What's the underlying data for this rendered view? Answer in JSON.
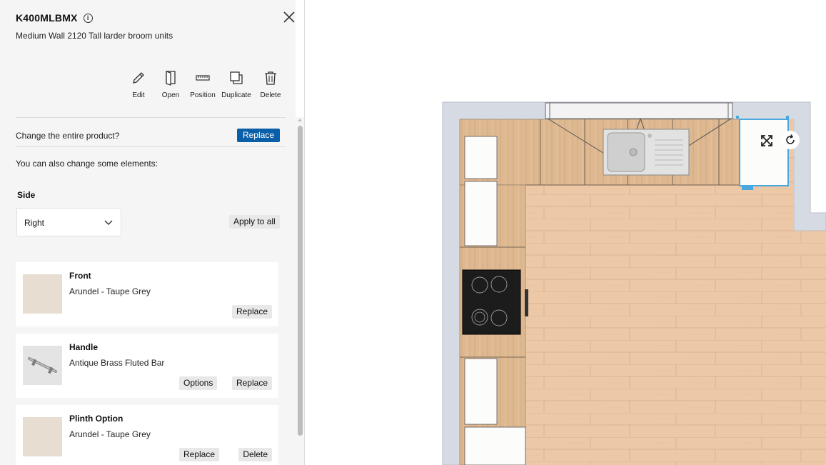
{
  "product": {
    "code": "K400MLBMX",
    "description": "Medium Wall 2120 Tall larder broom units"
  },
  "toolbar": {
    "edit": "Edit",
    "open": "Open",
    "position": "Position",
    "duplicate": "Duplicate",
    "delete": "Delete"
  },
  "change_product": {
    "text": "Change the entire product?",
    "button": "Replace"
  },
  "also_change": "You can also change some elements:",
  "side": {
    "label": "Side",
    "value": "Right",
    "apply_all": "Apply to all"
  },
  "elements": [
    {
      "name": "Front",
      "value": "Arundel - Taupe Grey",
      "replace": "Replace",
      "swatch": "#e7ddd1"
    },
    {
      "name": "Handle",
      "value": "Antique Brass Fluted Bar",
      "options": "Options",
      "replace": "Replace",
      "swatch": "#e4e4e4"
    },
    {
      "name": "Plinth Option",
      "value": "Arundel - Taupe Grey",
      "replace": "Replace",
      "delete": "Delete",
      "swatch": "#e7ddd1"
    }
  ],
  "colors": {
    "primary_button": "#0b5ea8",
    "selection": "#4aa8e0",
    "worktop": "#deb890",
    "floor": "#ecc8a6",
    "wall": "#d6dbe3"
  }
}
